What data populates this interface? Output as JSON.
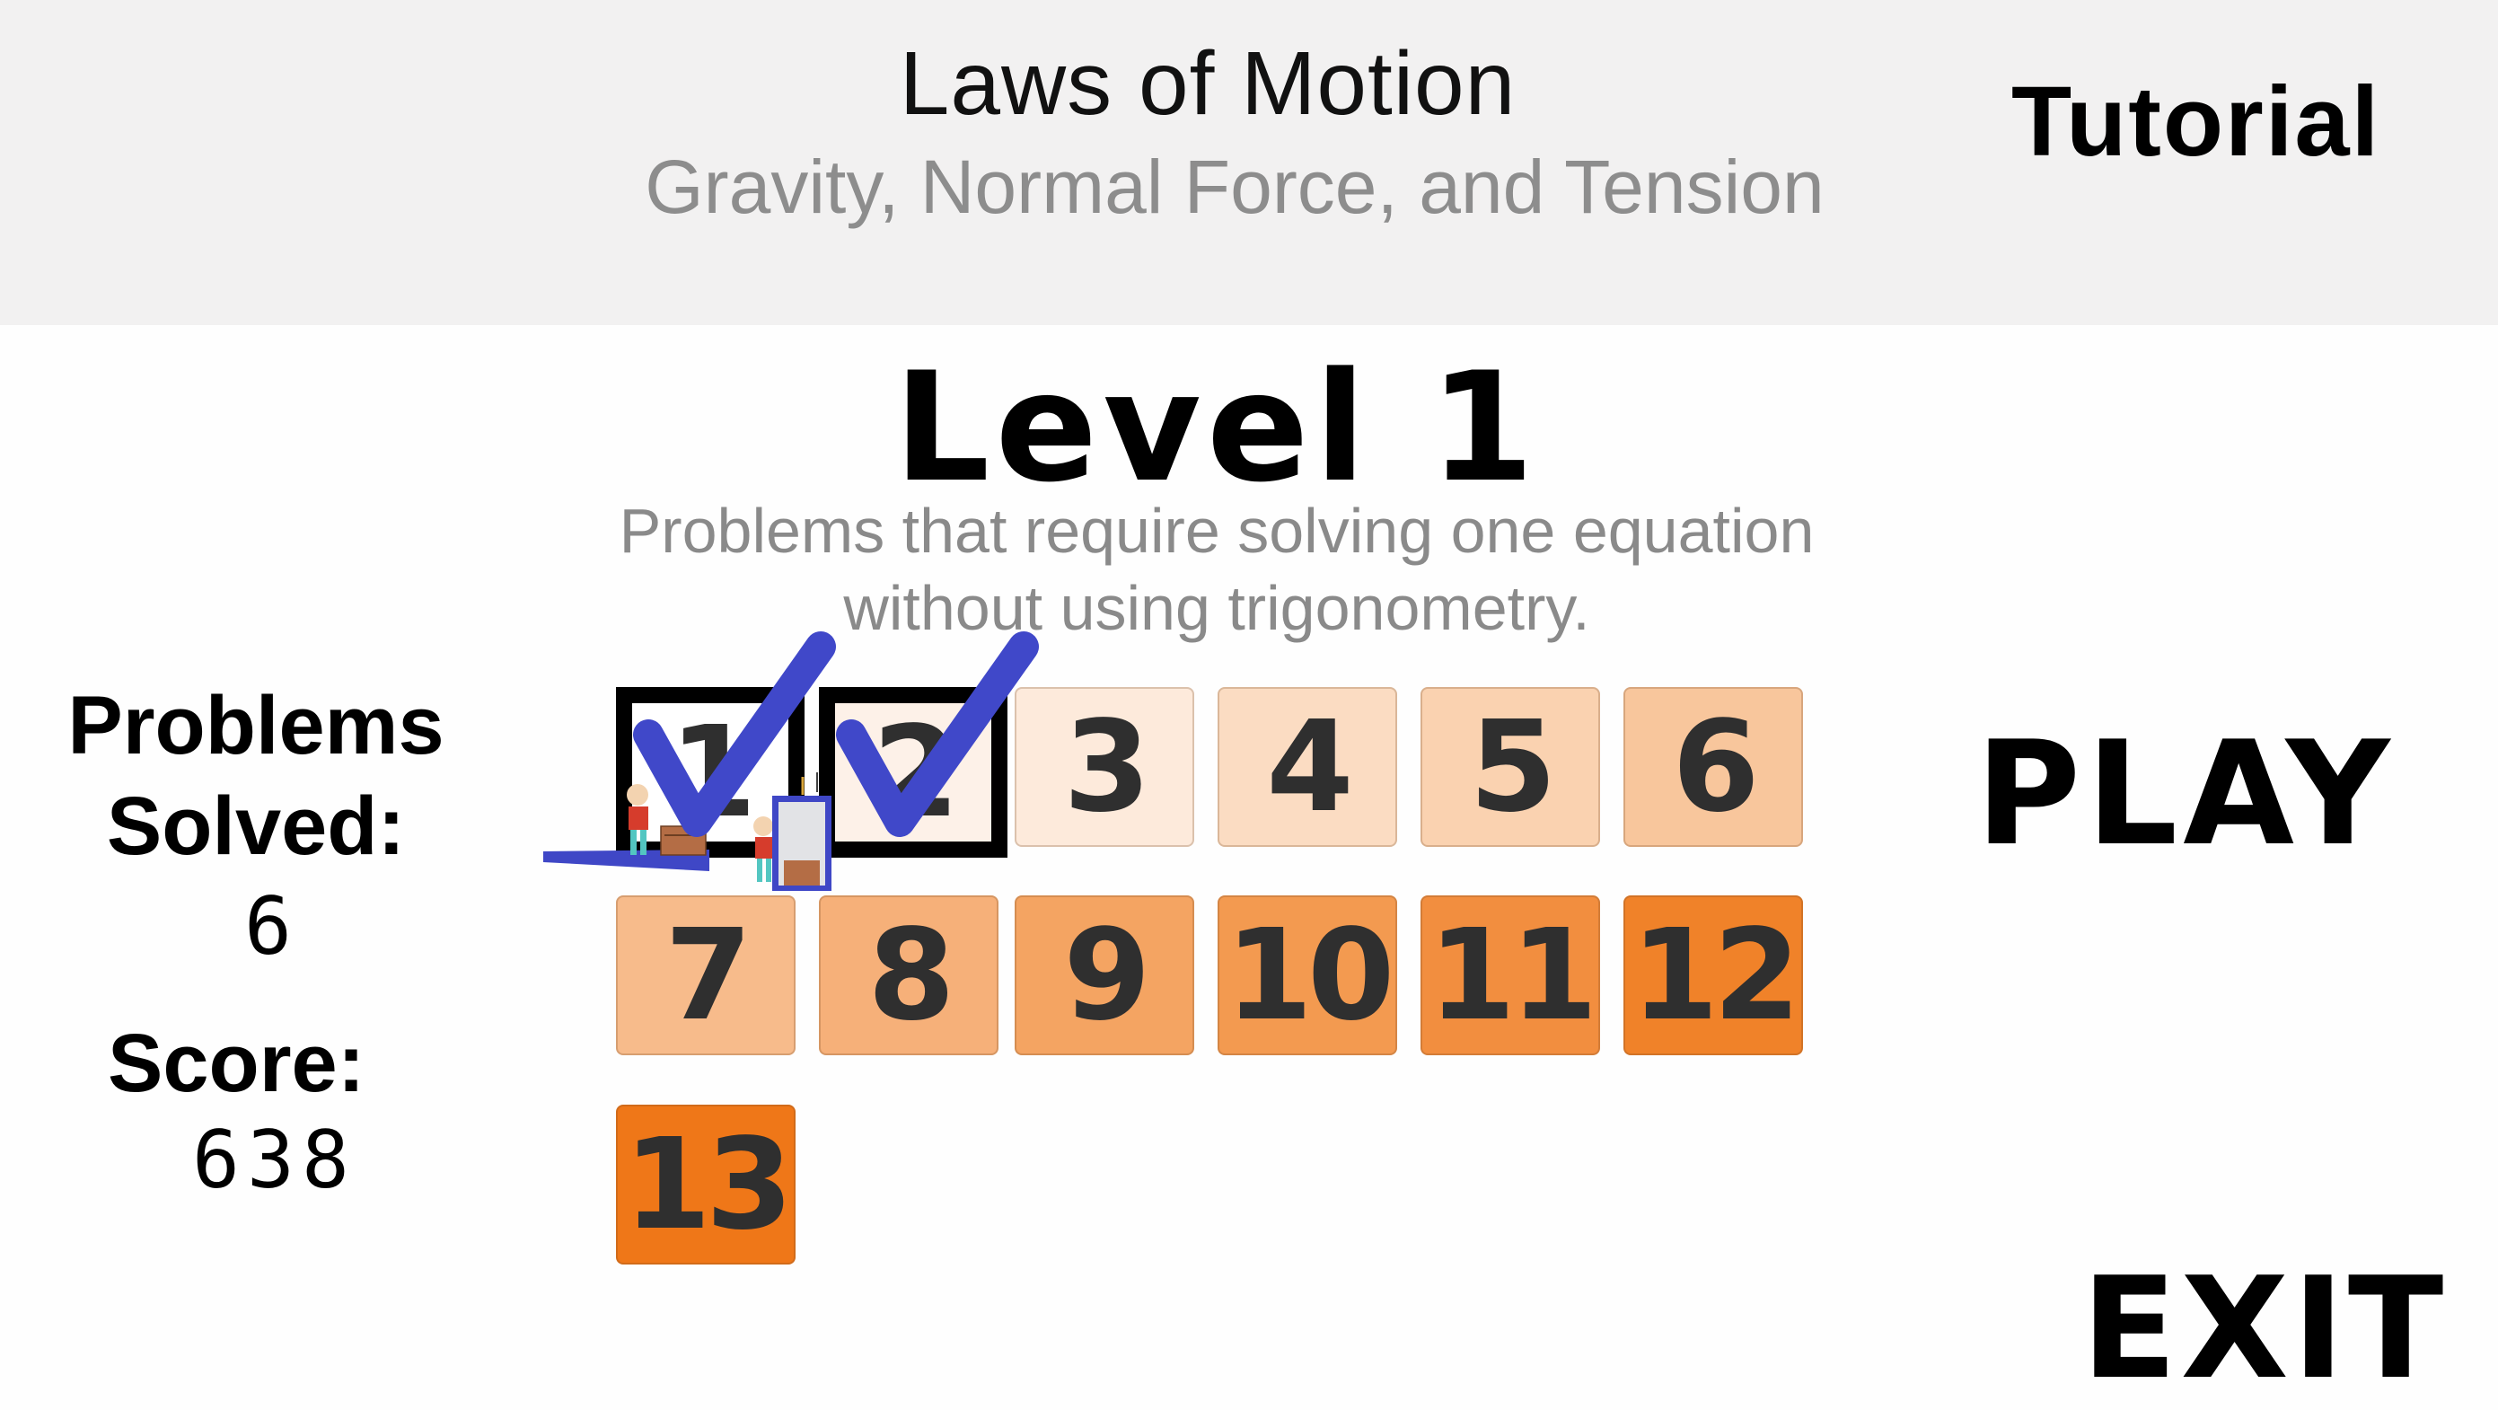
{
  "header": {
    "title": "Laws of Motion",
    "subtitle": "Gravity, Normal Force, and Tension",
    "tutorial_label": "Tutorial"
  },
  "level": {
    "title": "Level 1",
    "description_line1": "Problems that require solving one equation",
    "description_line2": "without using trigonometry."
  },
  "stats": {
    "problems_label_line1": "Problems",
    "problems_label_line2": "Solved:",
    "problems_solved": "6",
    "score_label": "Score:",
    "score": "638"
  },
  "problems": [
    {
      "label": "1",
      "color": "#ffffff",
      "solved": true
    },
    {
      "label": "2",
      "color": "#fdf1e8",
      "solved": true
    },
    {
      "label": "3",
      "color": "#fdeadb",
      "solved": false
    },
    {
      "label": "4",
      "color": "#fbdcc2",
      "solved": false
    },
    {
      "label": "5",
      "color": "#fad2b0",
      "solved": false
    },
    {
      "label": "6",
      "color": "#f8c69c",
      "solved": false
    },
    {
      "label": "7",
      "color": "#f7bb8b",
      "solved": false
    },
    {
      "label": "8",
      "color": "#f6b079",
      "solved": false
    },
    {
      "label": "9",
      "color": "#f4a462",
      "solved": false
    },
    {
      "label": "10",
      "color": "#f39a50",
      "solved": false
    },
    {
      "label": "11",
      "color": "#f28e3f",
      "solved": false
    },
    {
      "label": "12",
      "color": "#f08229",
      "solved": false
    },
    {
      "label": "13",
      "color": "#ef7718",
      "solved": false
    }
  ],
  "checkmark_color": "#4048c9",
  "play_label": "PLAY",
  "exit_label": "EXIT"
}
